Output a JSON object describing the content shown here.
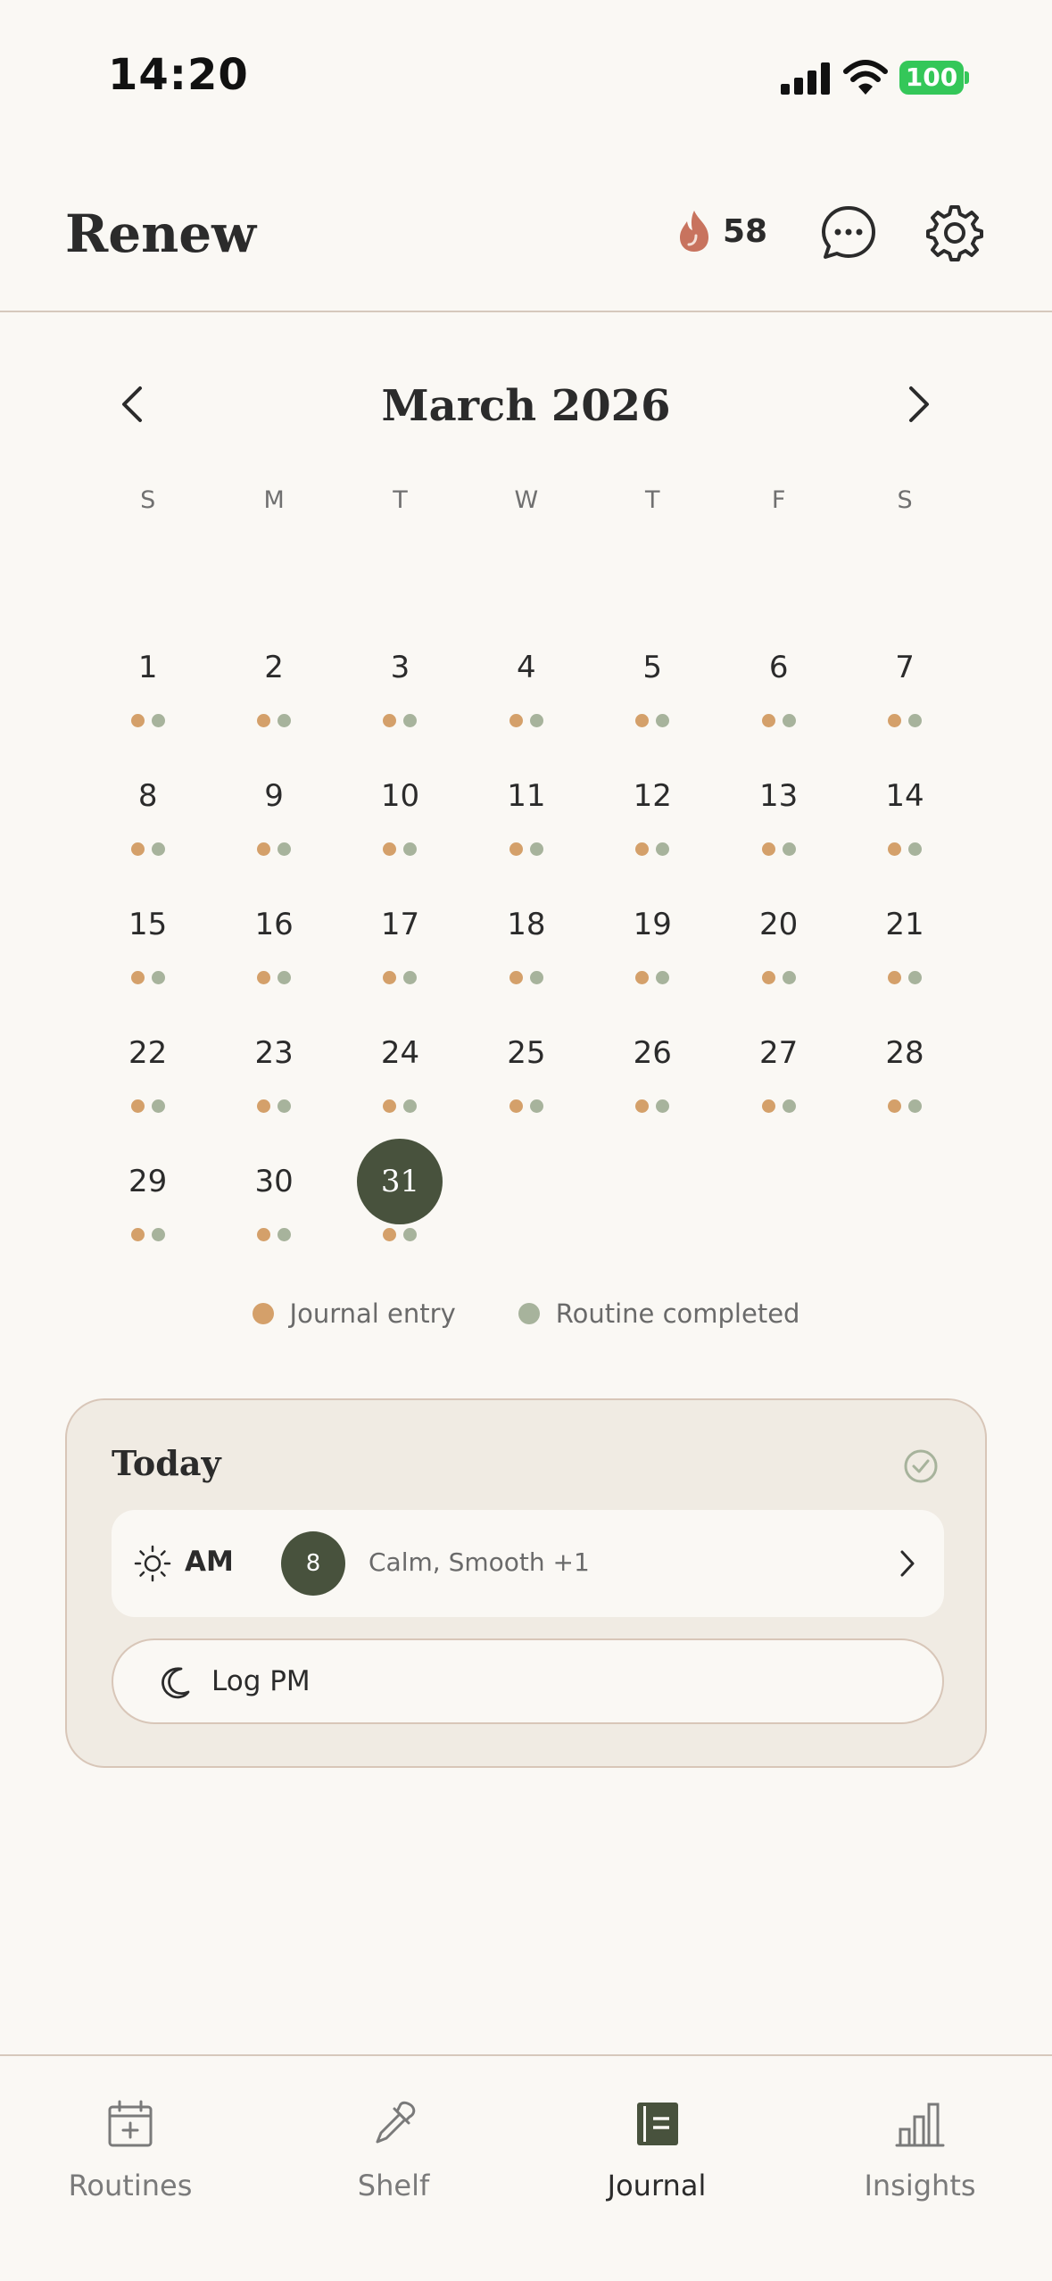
{
  "status_bar": {
    "time": "14:20",
    "battery": "100"
  },
  "header": {
    "title": "Renew",
    "streak_count": "58"
  },
  "calendar": {
    "month_title": "March 2026",
    "weekdays": [
      "S",
      "M",
      "T",
      "W",
      "T",
      "F",
      "S"
    ],
    "leading_blanks": 0,
    "today": 31,
    "days": [
      {
        "n": "1",
        "journal": true,
        "routine": true
      },
      {
        "n": "2",
        "journal": true,
        "routine": true
      },
      {
        "n": "3",
        "journal": true,
        "routine": true
      },
      {
        "n": "4",
        "journal": true,
        "routine": true
      },
      {
        "n": "5",
        "journal": true,
        "routine": true
      },
      {
        "n": "6",
        "journal": true,
        "routine": true
      },
      {
        "n": "7",
        "journal": true,
        "routine": true
      },
      {
        "n": "8",
        "journal": true,
        "routine": true
      },
      {
        "n": "9",
        "journal": true,
        "routine": true
      },
      {
        "n": "10",
        "journal": true,
        "routine": true
      },
      {
        "n": "11",
        "journal": true,
        "routine": true
      },
      {
        "n": "12",
        "journal": true,
        "routine": true
      },
      {
        "n": "13",
        "journal": true,
        "routine": true
      },
      {
        "n": "14",
        "journal": true,
        "routine": true
      },
      {
        "n": "15",
        "journal": true,
        "routine": true
      },
      {
        "n": "16",
        "journal": true,
        "routine": true
      },
      {
        "n": "17",
        "journal": true,
        "routine": true
      },
      {
        "n": "18",
        "journal": true,
        "routine": true
      },
      {
        "n": "19",
        "journal": true,
        "routine": true
      },
      {
        "n": "20",
        "journal": true,
        "routine": true
      },
      {
        "n": "21",
        "journal": true,
        "routine": true
      },
      {
        "n": "22",
        "journal": true,
        "routine": true
      },
      {
        "n": "23",
        "journal": true,
        "routine": true
      },
      {
        "n": "24",
        "journal": true,
        "routine": true
      },
      {
        "n": "25",
        "journal": true,
        "routine": true
      },
      {
        "n": "26",
        "journal": true,
        "routine": true
      },
      {
        "n": "27",
        "journal": true,
        "routine": true
      },
      {
        "n": "28",
        "journal": true,
        "routine": true
      },
      {
        "n": "29",
        "journal": true,
        "routine": true
      },
      {
        "n": "30",
        "journal": true,
        "routine": true
      },
      {
        "n": "31",
        "journal": true,
        "routine": true
      }
    ]
  },
  "legend": {
    "journal": "Journal entry",
    "routine": "Routine completed"
  },
  "today_card": {
    "title": "Today",
    "am_label": "AM",
    "am_score": "8",
    "am_tags": "Calm, Smooth +1",
    "pm_label": "Log PM"
  },
  "tabs": [
    {
      "label": "Routines",
      "icon": "calendar-plus-icon"
    },
    {
      "label": "Shelf",
      "icon": "dropper-icon"
    },
    {
      "label": "Journal",
      "icon": "journal-icon"
    },
    {
      "label": "Insights",
      "icon": "bar-chart-icon"
    }
  ],
  "active_tab": "Journal",
  "colors": {
    "accent": "#48523d",
    "journal_dot": "#d4a06a",
    "routine_dot": "#a7b39c",
    "streak_flame": "#c8735e",
    "background": "#faf8f4",
    "card": "#f0ebe3"
  }
}
